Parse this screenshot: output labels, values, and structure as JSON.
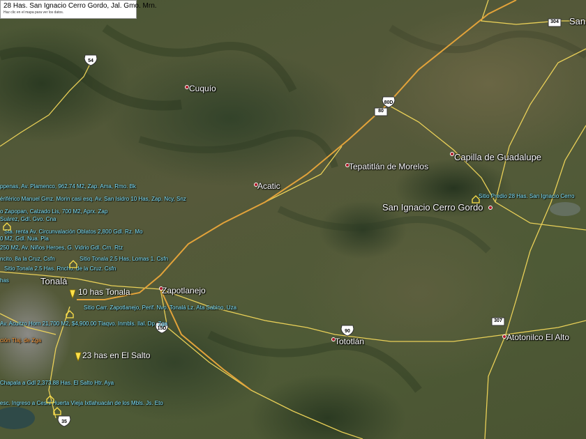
{
  "header": {
    "title": "28 Has. San Ignacio Cerro Gordo, Jal. Gmo. Mrn.",
    "subtitle": "Haz clic en el mapa para ver los datos."
  },
  "places": {
    "cuquio": "Cuquío",
    "acatic": "Acatic",
    "tepatitlan": "Tepatitlán de Morelos",
    "capilla": "Capilla de Guadalupe",
    "san_ignacio": "San Ignacio Cerro Gordo",
    "zapotlanejo": "Zapotlanejo",
    "tototlan": "Tototlán",
    "atotonilco": "Atotonilco El Alto",
    "tonala": "Tonalá",
    "san_corner": "San"
  },
  "shields": {
    "r54": "54",
    "r80d": "80D",
    "r80": "80",
    "r304": "304",
    "r90": "90",
    "r307": "307",
    "r15d": "15D",
    "r35": "35"
  },
  "markers": {
    "tonala_10": "10 has Tonala",
    "salto_23": "23 has en El Salto"
  },
  "listings": {
    "l1": "ppenas, Av. Plamenco, 962.74 M2, Zap. Ama, Rmo. Bk",
    "l2": "ériférico Manuel Gmz. Morin casi esq. Av. San Isidro 10 Has, Zap. Ncy, Snz",
    "l3": "o Zapopan, Calzado Lis, 700 M2, Aprx. Zap",
    "l4": "Suárez, Gdl. Gvo. Cna",
    "l5": "Sta. renta Av. Circunvalación Oblatos 2,800 Gdl. Rz. Mo",
    "l6": "0 M2, Gdl. Nua. Pla",
    "l7": "250 M2, Av. Niños Heroes, G. Vidrio Gdl. Crn. Rtz",
    "l8": "ncito, 8a la Cruz, Csfn",
    "l9": "Sitio Tonala 2.5 Has, Lomas 1. Csfn",
    "l10": "Sitio Tonala 2.5 Has. Rncho. de la Cruz. Csfn",
    "l11": "has",
    "l12": "Sitio Carr. Zapotlanejo, Perif. Nvo. Tonalá Lz. Ata Sabino. Uza",
    "l13": "Av. Acuitzo Horn 21,700 M2, $4,900.00 Tlaqvo. Inmbls. Ilal. Dp. Zga",
    "l14": "ción Tlaj. de Zga",
    "l15": "Chapala a Gdl 2,373.88 Has. El Salto Htr. Aya",
    "l16": "esc. Ingreso a Cesnl Huerta Vieja Ixtlahuacán de los Mbls. Js. Eto",
    "sitio_predio": "Sitio Predio 28 Has. San Ignacio Cerro"
  },
  "colors": {
    "road": "#f2d75a",
    "highway": "#e3a33a",
    "listing_cyan": "#7fe4ff",
    "pin_yellow": "#ffe24a",
    "place_dot": "#b01a2a"
  }
}
